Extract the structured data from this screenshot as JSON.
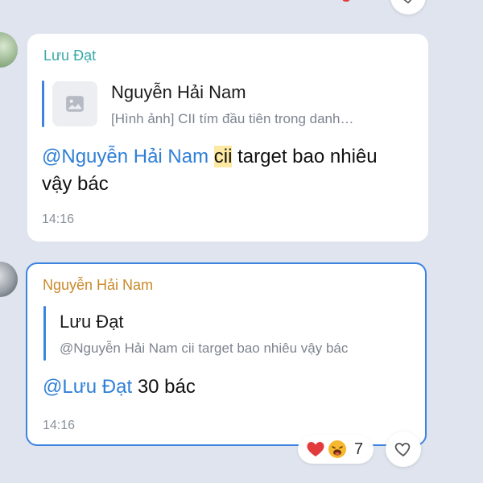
{
  "messages": [
    {
      "sender": "Lưu Đạt",
      "sender_color": "#3aa8a8",
      "quote": {
        "title": "Nguyễn Hải Nam",
        "snippet": "[Hình ảnh] CII tím đầu tiên trong danh…",
        "thumb_icon": "image-icon"
      },
      "mention": "@Nguyễn Hải Nam",
      "highlight": "cii",
      "text_line1": "target bao nhiêu",
      "text_line2": "vậy bác",
      "time": "14:16"
    },
    {
      "sender": "Nguyễn Hải Nam",
      "sender_color": "#c88a2a",
      "quote": {
        "title": "Lưu Đạt",
        "snippet": "@Nguyễn Hải Nam cii target bao nhiêu vậy bác"
      },
      "mention": "@Lưu Đạt",
      "text": "30 bác",
      "time": "14:16",
      "reactions": {
        "emojis": [
          "heart-emoji",
          "laughing-emoji"
        ],
        "count": "7"
      }
    }
  ],
  "colors": {
    "background": "#dfe4ee",
    "mention": "#2f7fd6",
    "selected_border": "#3c84e0",
    "heart": "#e23b3b"
  }
}
